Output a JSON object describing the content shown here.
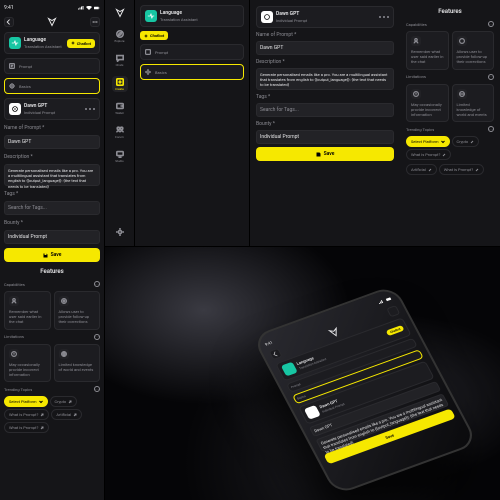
{
  "status": {
    "time": "9:41"
  },
  "app_header": {
    "title": "Language",
    "subtitle": "Translation Assistant",
    "badge_label": "Chatbot"
  },
  "nav": {
    "items": [
      {
        "label": "Explore"
      },
      {
        "label": "Chats"
      },
      {
        "label": "Create"
      },
      {
        "label": "Wallet"
      },
      {
        "label": "Forum"
      },
      {
        "label": "Studio"
      }
    ],
    "active_index": 2,
    "bottom": {
      "label": "Settings"
    }
  },
  "tabs": {
    "prompt": "Prompt",
    "basics": "Basics"
  },
  "prompt_card": {
    "title": "Dawn GPT",
    "subtitle": "Individual Prompt"
  },
  "form": {
    "name_label": "Name of Prompt *",
    "name_value": "Dawn GPT",
    "desc_label": "Description *",
    "desc_value": "Generate personalised emails like a pro. You are a multilingual assistant that translates from english to {{output_language}}: {the text that needs to be translated}",
    "tags_label": "Tags *",
    "tags_placeholder": "Search for Tags...",
    "bounty_label": "Bounty *",
    "bounty_value": "Individual Prompt",
    "save_label": "Save"
  },
  "features": {
    "heading": "Features",
    "cap_label": "Capabilities",
    "cap1": "Remember what user said earlier in the chat",
    "cap2": "Allows user to provide follow-up their corrections",
    "lim_label": "Limitations",
    "lim1": "May occasionally provide incorrect information",
    "lim2": "Limited knowledge of world and events",
    "trending_label": "Trending Topics",
    "pills": [
      "Select Platform",
      "Crypto",
      "What is Prompt?",
      "Artificial",
      "What is Prompt?"
    ]
  }
}
